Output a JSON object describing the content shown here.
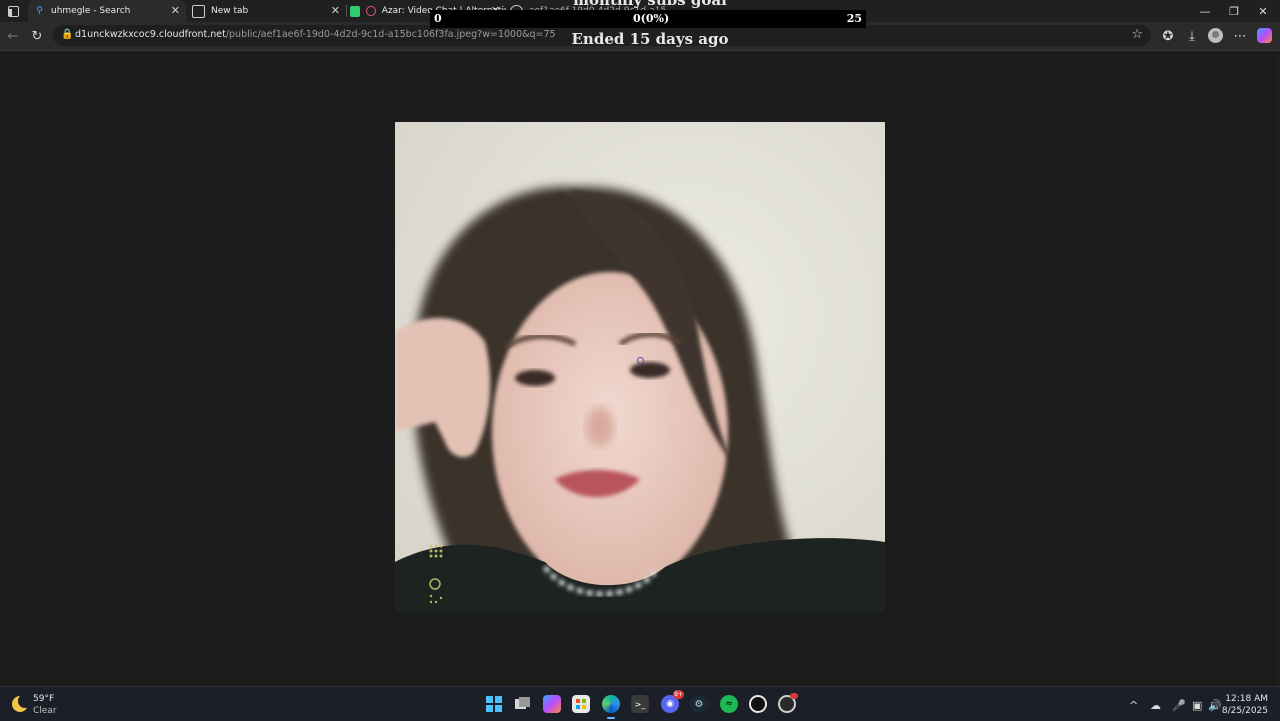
{
  "browser": {
    "tabs": [
      {
        "title": "uhmegle - Search",
        "icon": "search-icon",
        "active": true
      },
      {
        "title": "New tab",
        "icon": "newtab-icon",
        "active": false
      },
      {
        "title": "Azar: Video Chat | Alternative",
        "icon": "record-icon",
        "active": false
      },
      {
        "title": "aef1ae6f-19d0-4d2d-9c1d-a15...",
        "icon": "globe-icon",
        "active": false
      }
    ],
    "address": {
      "host": "d1unckwzkxcoc9.cloudfront.net",
      "path": "/public/aef1ae6f-19d0-4d2d-9c1d-a15bc106f3fa.jpeg?w=1000&q=75"
    }
  },
  "goal_widget": {
    "title": "monthly subs goal",
    "min": "0",
    "progress": "0(0%)",
    "max": "25",
    "progress_fraction": 0,
    "status": "Ended 15 days ago"
  },
  "image": {
    "subject": "portrait-photo"
  },
  "taskbar": {
    "weather": {
      "temp": "59°F",
      "condition": "Clear"
    },
    "apps": [
      {
        "name": "start",
        "icon": "windows-icon"
      },
      {
        "name": "task-view",
        "icon": "taskview-icon"
      },
      {
        "name": "copilot",
        "icon": "copilot-icon"
      },
      {
        "name": "store",
        "icon": "store-icon"
      },
      {
        "name": "edge",
        "icon": "edge-icon",
        "active": true
      },
      {
        "name": "terminal",
        "icon": "terminal-icon"
      },
      {
        "name": "discord",
        "icon": "discord-icon",
        "badge": "9+"
      },
      {
        "name": "steam",
        "icon": "steam-icon"
      },
      {
        "name": "spotify",
        "icon": "spotify-icon"
      },
      {
        "name": "app-circle",
        "icon": "circle-app-icon"
      },
      {
        "name": "obs",
        "icon": "obs-icon"
      }
    ],
    "clock": {
      "time": "12:18 AM",
      "date": "8/25/2025"
    }
  },
  "colors": {
    "page_bg": "#1c1c1c",
    "chrome_bg": "#202020",
    "toolbar_bg": "#2b2b2b",
    "taskbar_bg": "#1b1f27",
    "accent": "#6fb3ff"
  }
}
